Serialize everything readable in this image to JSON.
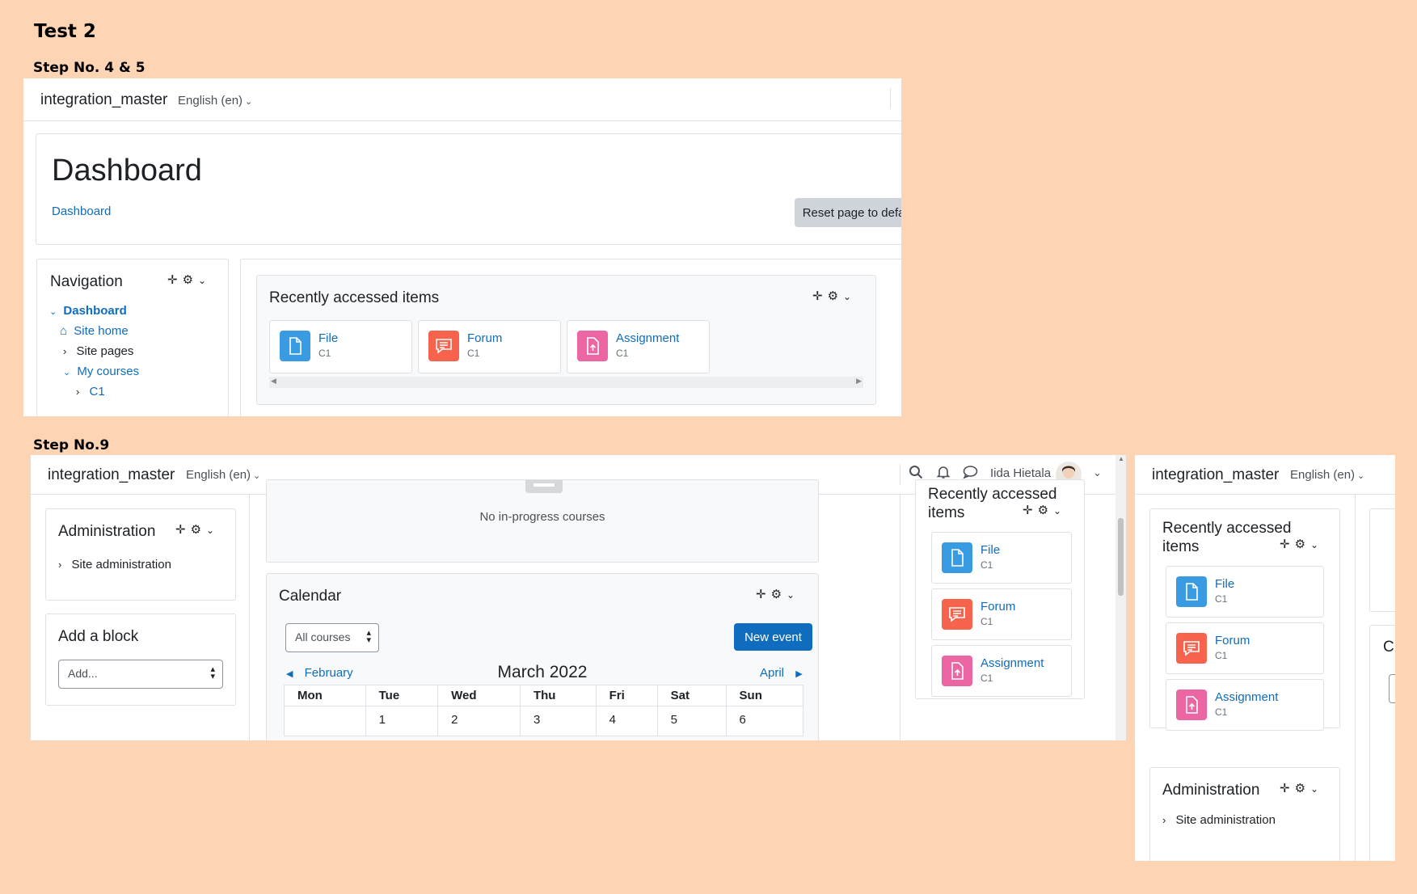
{
  "headings": {
    "test": "Test 2",
    "step_a": "Step No. 4 & 5",
    "step_b": "Step No.9"
  },
  "site": {
    "brand": "integration_master",
    "language": "English (en)"
  },
  "dashboard": {
    "title": "Dashboard",
    "breadcrumb": "Dashboard",
    "reset_button": "Reset page to default"
  },
  "navigation": {
    "title": "Navigation",
    "items": [
      {
        "label": "Dashboard"
      },
      {
        "label": "Site home"
      },
      {
        "label": "Site pages"
      },
      {
        "label": "My courses"
      },
      {
        "label": "C1"
      }
    ]
  },
  "recent": {
    "title": "Recently accessed items",
    "title_line1": "Recently accessed",
    "title_line2": "items",
    "items": [
      {
        "name": "File",
        "course": "C1",
        "icon": "file-icon",
        "color": "#399be2"
      },
      {
        "name": "Forum",
        "course": "C1",
        "icon": "forum-icon",
        "color": "#f7634d"
      },
      {
        "name": "Assignment",
        "course": "C1",
        "icon": "assignment-icon",
        "color": "#eb66a2"
      }
    ]
  },
  "header_user": {
    "name": "Iida Hietala"
  },
  "course_overview": {
    "empty_text": "No in-progress courses"
  },
  "administration": {
    "title": "Administration",
    "item": "Site administration"
  },
  "add_block": {
    "title": "Add a block",
    "placeholder": "Add..."
  },
  "calendar": {
    "title": "Calendar",
    "filter": "All courses",
    "new_event": "New event",
    "prev_month": "February",
    "month": "March 2022",
    "next_month": "April",
    "weekdays": [
      "Mon",
      "Tue",
      "Wed",
      "Thu",
      "Fri",
      "Sat",
      "Sun"
    ],
    "week1": [
      "",
      "1",
      "2",
      "3",
      "4",
      "5",
      "6"
    ]
  },
  "cut_off_letter": "C",
  "colors": {
    "background": "#fdd5b4",
    "link": "#0f6cbf",
    "primary_button": "#0f6cbf"
  }
}
